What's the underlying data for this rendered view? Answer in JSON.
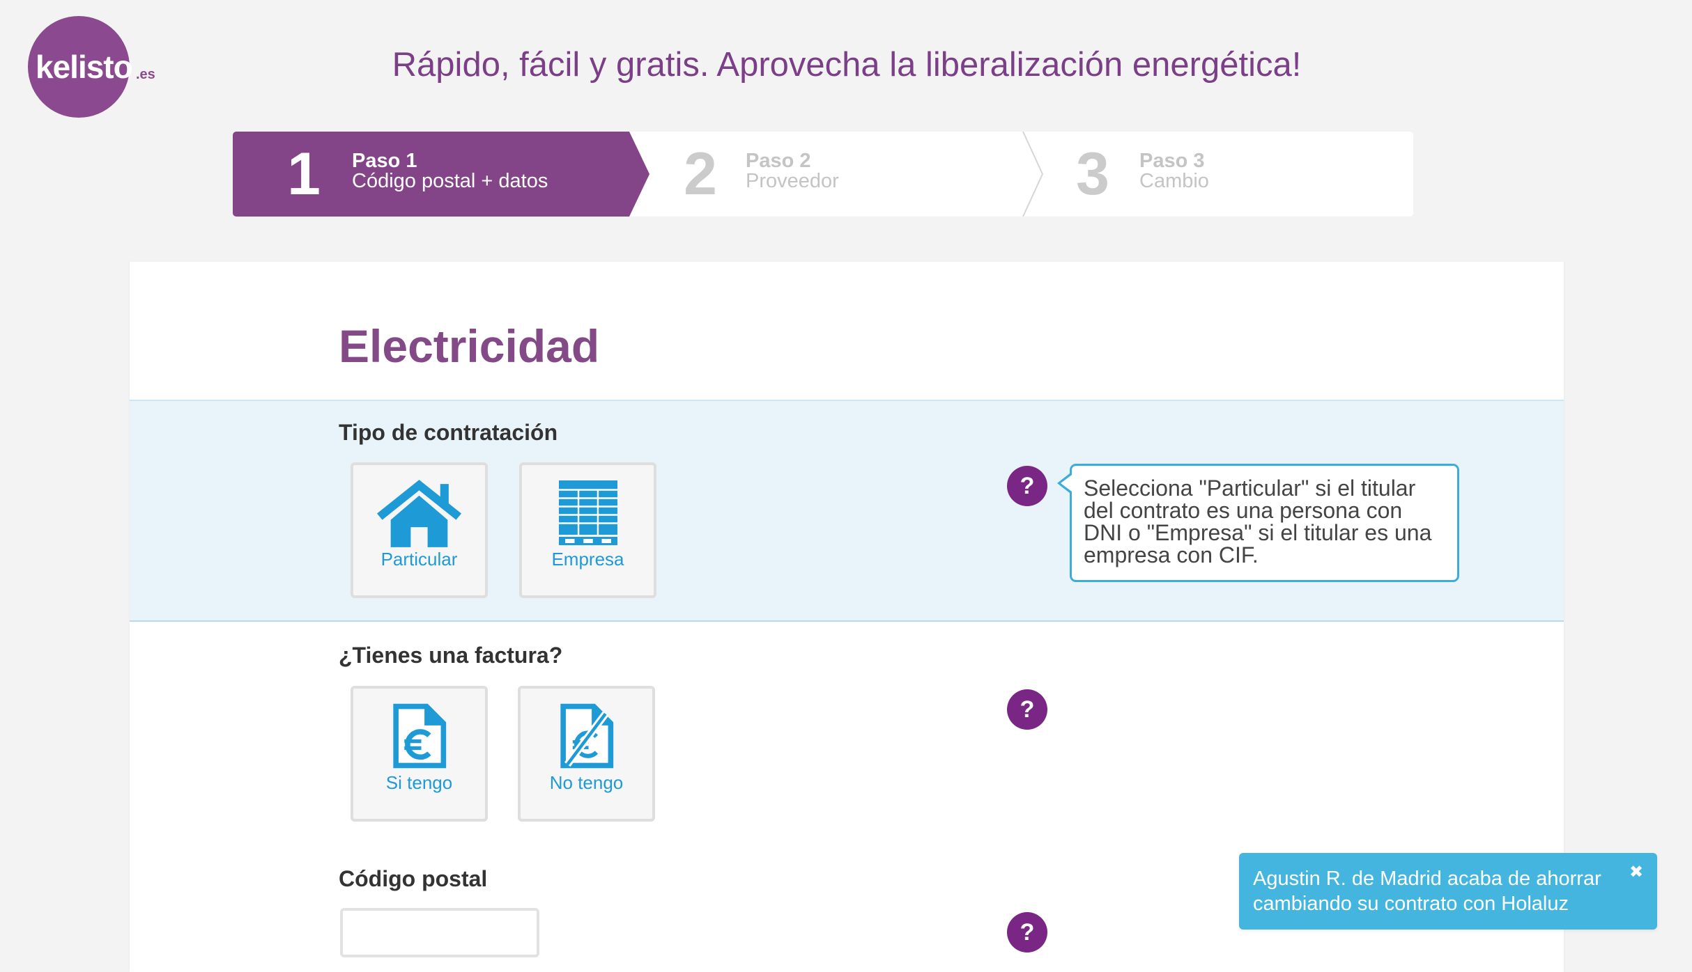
{
  "colors": {
    "brand_purple": "#834587",
    "help_purple": "#7a2685",
    "option_blue": "#1e9ad6",
    "section_highlight": "#e8f4fa",
    "tooltip_border": "#3aaddd",
    "toast_background": "#43b5de",
    "page_background": "#f3f3f3"
  },
  "header": {
    "logo": {
      "text": "kelisto",
      "suffix": ".es"
    },
    "tagline": "Rápido, fácil y gratis. Aprovecha la liberalización energética!"
  },
  "steps": [
    {
      "number": "1",
      "title": "Paso 1",
      "subtitle": "Código postal + datos",
      "active": true
    },
    {
      "number": "2",
      "title": "Paso 2",
      "subtitle": "Proveedor",
      "active": false
    },
    {
      "number": "3",
      "title": "Paso 3",
      "subtitle": "Cambio",
      "active": false
    }
  ],
  "form": {
    "title": "Electricidad",
    "contract_type": {
      "label": "Tipo de contratación",
      "options": [
        {
          "label": "Particular",
          "icon": "house-icon"
        },
        {
          "label": "Empresa",
          "icon": "building-icon"
        }
      ],
      "help": {
        "icon": "help-icon",
        "tooltip_lines": [
          "Selecciona \"Particular\" si el titular",
          "del contrato es una persona con",
          "DNI o \"Empresa\" si el titular es una",
          "empresa con CIF."
        ]
      }
    },
    "invoice": {
      "label": "¿Tienes una factura?",
      "options": [
        {
          "label": "Si tengo",
          "icon": "invoice-euro-icon"
        },
        {
          "label": "No tengo",
          "icon": "no-invoice-icon"
        }
      ],
      "help": {
        "icon": "help-icon"
      }
    },
    "postal_code": {
      "label": "Código postal",
      "value": "",
      "help": {
        "icon": "help-icon"
      }
    }
  },
  "notification": {
    "lines": [
      "Agustin R. de Madrid acaba de ahorrar",
      "cambiando su contrato con Holaluz"
    ],
    "close_icon": "close-icon"
  }
}
